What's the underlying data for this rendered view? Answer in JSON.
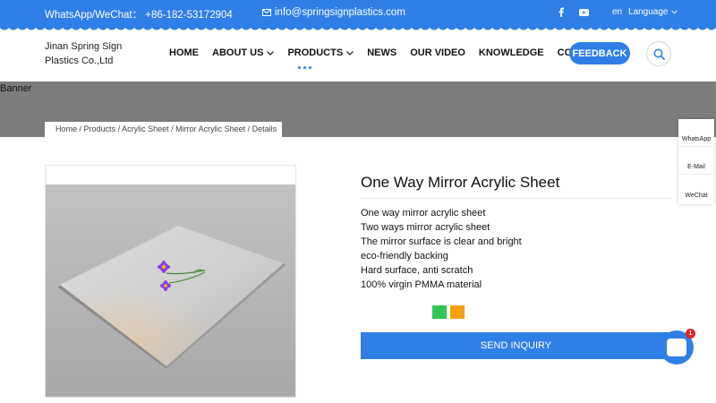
{
  "topbar": {
    "whatsapp_text": "WhatsApp/WeChat： +86-182-53172904",
    "email": "info@springsignplastics.com",
    "social_icons": [
      "facebook-icon",
      "youtube-icon"
    ],
    "lang_code": "en",
    "lang_label": "Language"
  },
  "header": {
    "logo_line1": "Jinan Spring Sign",
    "logo_line2": "Plastics Co.,Ltd",
    "nav": [
      {
        "label": "HOME"
      },
      {
        "label": "ABOUT US"
      },
      {
        "label": "PRODUCTS"
      },
      {
        "label": "NEWS"
      },
      {
        "label": "OUR VIDEO"
      },
      {
        "label": "KNOWLEDGE"
      },
      {
        "label": "CONTACT US"
      }
    ],
    "feedback_label": "FEEDBACK"
  },
  "banner": {
    "label": "Banner",
    "breadcrumb": [
      "Home",
      "Products",
      "Acrylic Sheet",
      "Mirror Acrylic Sheet",
      "Details"
    ]
  },
  "product": {
    "title": "One Way Mirror Acrylic Sheet",
    "features": [
      "One way mirror acrylic sheet",
      "Two ways mirror acrylic sheet",
      "The mirror surface is clear and bright",
      "eco-friendly backing",
      "Hard surface, anti scratch",
      "100% virgin PMMA material"
    ],
    "inquiry_label": "SEND INQUIRY"
  },
  "side_panel": [
    "WhatsApp",
    "E-Mail",
    "WeChat"
  ],
  "chat": {
    "badge_count": "1"
  },
  "colors": {
    "primary": "#2f7fe6",
    "banner": "#7c7c7c",
    "share_green": "#2dc657",
    "share_orange": "#f5a00c"
  }
}
